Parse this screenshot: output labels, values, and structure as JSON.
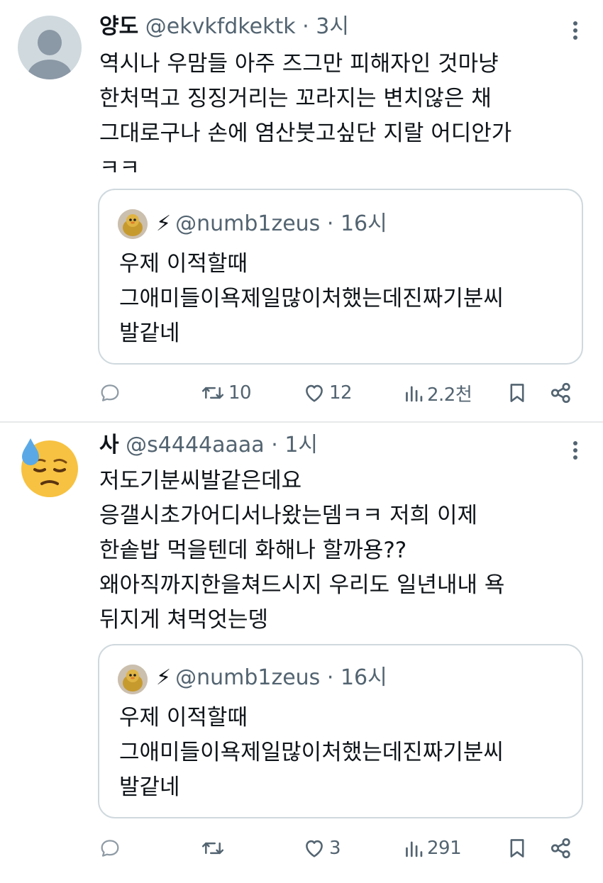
{
  "tweets": [
    {
      "name": "양도",
      "handle": "@ekvkfdkektk",
      "separator": "·",
      "time": "3시",
      "text": "역시나 우맘들 아주 즈그만 피해자인 것마냥\n한처먹고 징징거리는 꼬라지는 변치않은 채\n그대로구나 손에 염산붓고싶단 지랄 어디안가\nㅋㅋ",
      "avatar_icon": "default-avatar-icon",
      "quote": {
        "bolt": "⚡",
        "handle": "@numb1zeus",
        "separator": "·",
        "time": "16시",
        "text": "우제 이적할때\n그애미들이욕제일많이처했는데진짜기분씨\n발같네"
      },
      "actions": {
        "reply": "",
        "retweet": "10",
        "like": "12",
        "views": "2.2천"
      }
    },
    {
      "name": "사",
      "handle": "@s4444aaaa",
      "separator": "·",
      "time": "1시",
      "text": "저도기분씨발같은데요\n응갤시초가어디서나왔는뎀ㅋㅋ 저희 이제\n한솥밥 먹을텐데 화해나 할까용??\n왜아직까지한을쳐드시지 우리도 일년내내 욕\n뒤지게 쳐먹엇는뎅",
      "avatar_icon": "downcast-sweat-face-emoji-icon",
      "quote": {
        "bolt": "⚡",
        "handle": "@numb1zeus",
        "separator": "·",
        "time": "16시",
        "text": "우제 이적할때\n그애미들이욕제일많이처했는데진짜기분씨\n발같네"
      },
      "actions": {
        "reply": "",
        "retweet": "",
        "like": "3",
        "views": "291"
      }
    }
  ],
  "colors": {
    "text_primary": "#0f1419",
    "text_secondary": "#536471",
    "border": "#cfd9de",
    "divider": "#e7e9ea",
    "emoji_yellow": "#f7c242",
    "sweat_blue": "#5aa9e6"
  }
}
